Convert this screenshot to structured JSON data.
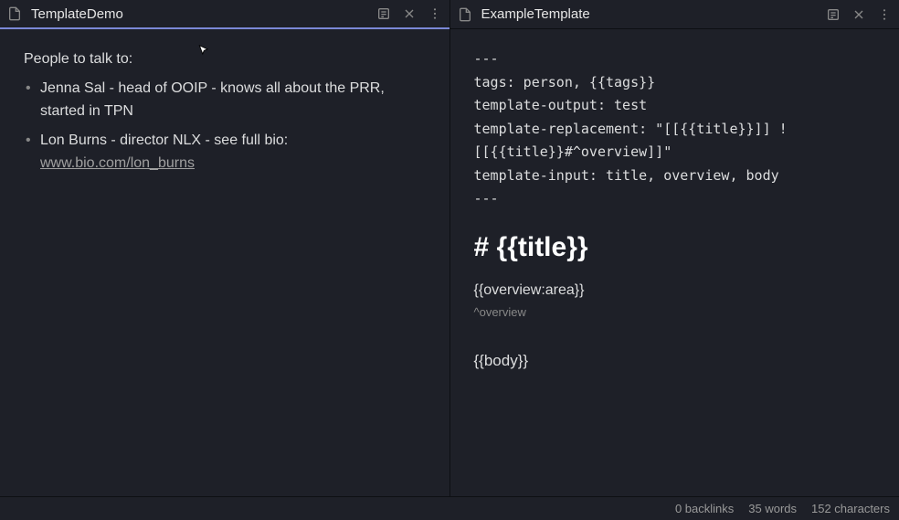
{
  "panes": [
    {
      "title": "TemplateDemo",
      "active": true,
      "content": {
        "heading": "People to talk to:",
        "items": [
          {
            "text": "Jenna Sal - head of OOIP - knows all about the PRR, started in TPN"
          },
          {
            "text_prefix": "Lon Burns - director NLX - see full bio: ",
            "link": "www.bio.com/lon_burns"
          }
        ]
      }
    },
    {
      "title": "ExampleTemplate",
      "active": false,
      "content": {
        "frontmatter": "---\ntags: person, {{tags}}\ntemplate-output: test\ntemplate-replacement: \"[[{{title}}]] ![[{{title}}#^overview]]\"\ntemplate-input: title, overview, body\n---",
        "h1": "# {{title}}",
        "overview": "{{overview:area}}",
        "overview_ref": "^overview",
        "body": "{{body}}"
      }
    }
  ],
  "statusbar": {
    "backlinks": "0 backlinks",
    "words": "35 words",
    "chars": "152 characters"
  }
}
